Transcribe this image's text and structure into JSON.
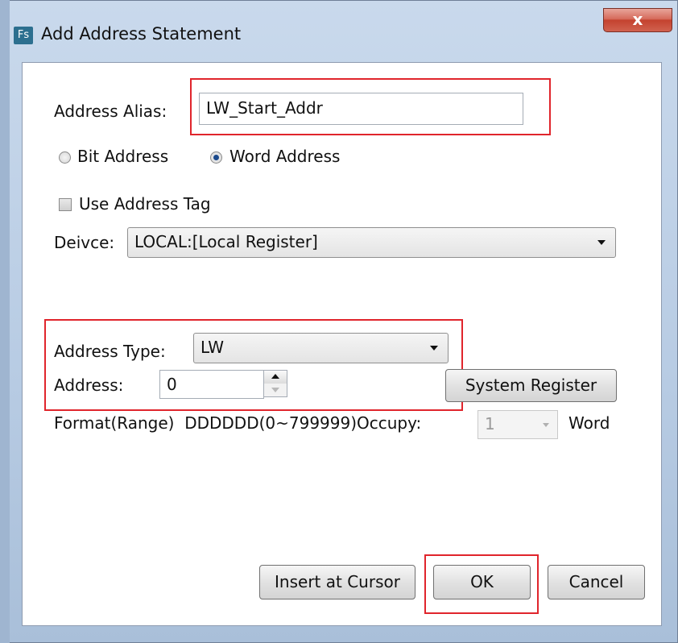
{
  "window": {
    "title": "Add Address Statement",
    "icon_text": "Fs",
    "close_symbol": "x"
  },
  "alias": {
    "label": "Address Alias:",
    "value": "LW_Start_Addr"
  },
  "address_kind": {
    "bit_label": "Bit Address",
    "word_label": "Word Address",
    "selected": "Word Address"
  },
  "use_tag": {
    "label": "Use Address Tag",
    "checked": false
  },
  "device": {
    "label": "Deivce:",
    "value": "LOCAL:[Local Register]"
  },
  "address_type": {
    "label": "Address Type:",
    "value": "LW"
  },
  "address": {
    "label": "Address:",
    "value": "0"
  },
  "system_register": {
    "label": "System Register"
  },
  "format": {
    "text": "Format(Range)  DDDDDD(0~799999)Occupy:",
    "occupy_value": "1",
    "unit": "Word"
  },
  "buttons": {
    "insert_label": "Insert at Cursor",
    "ok_label": "OK",
    "cancel_label": "Cancel"
  },
  "colors": {
    "highlight": "#e0252c",
    "close_button": "#c4422f",
    "title_bar": "#c9d9ec"
  }
}
